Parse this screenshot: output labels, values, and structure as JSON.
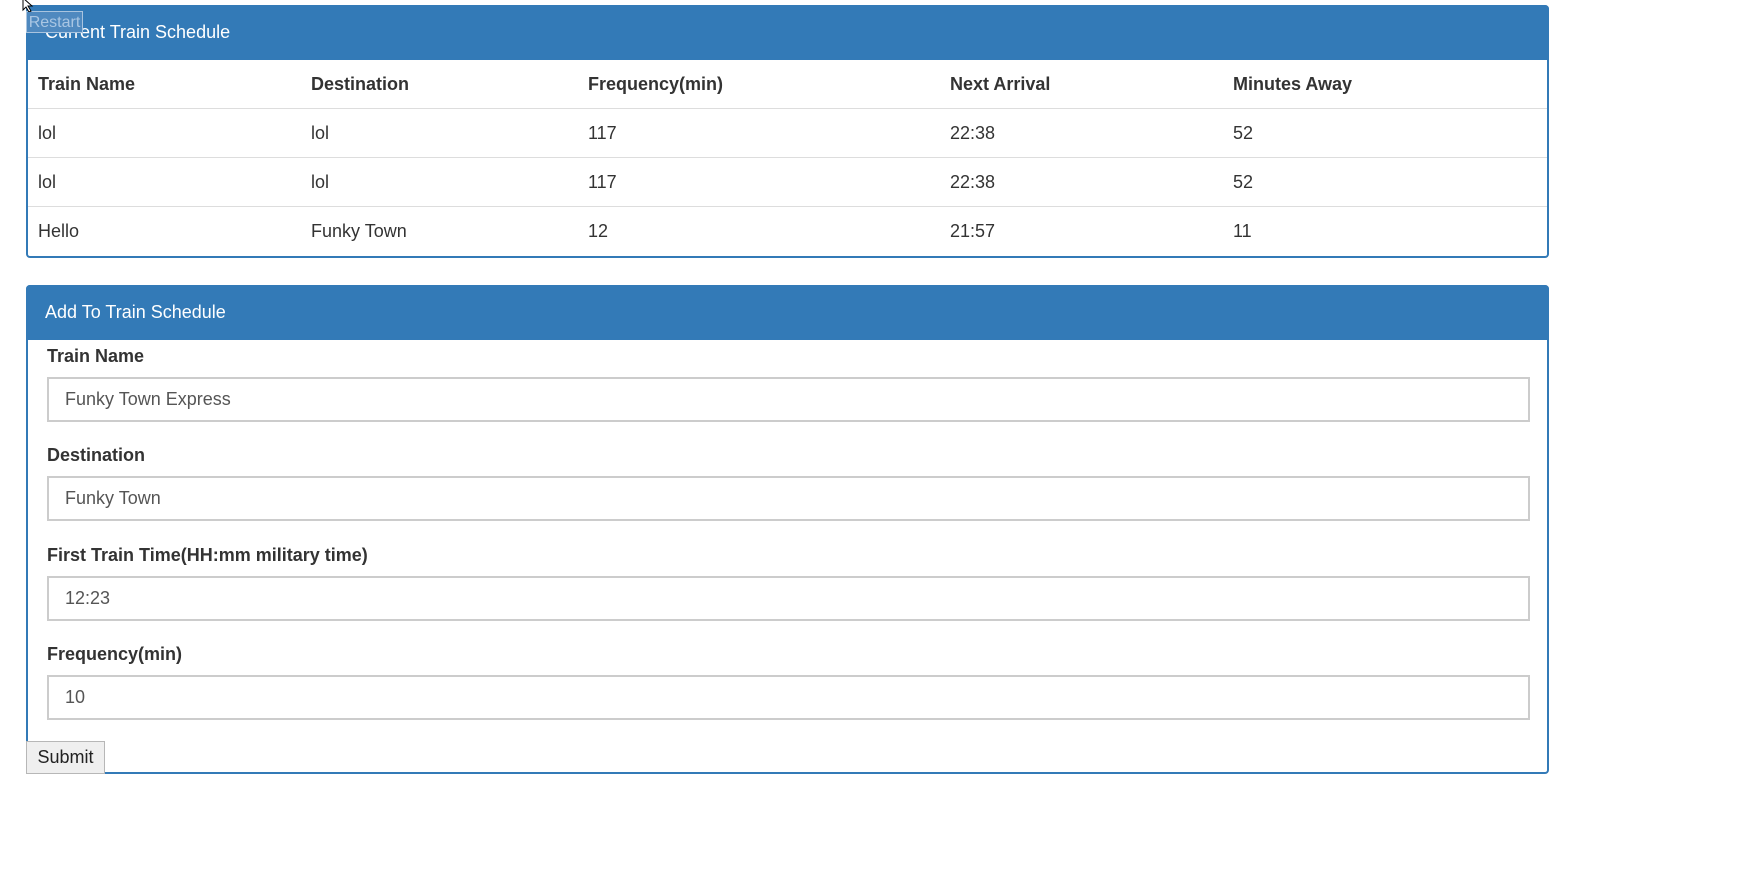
{
  "restart_label": "Restart",
  "schedule": {
    "title": "Current Train Schedule",
    "columns": [
      "Train Name",
      "Destination",
      "Frequency(min)",
      "Next Arrival",
      "Minutes Away"
    ],
    "rows": [
      [
        "lol",
        "lol",
        "117",
        "22:38",
        "52"
      ],
      [
        "lol",
        "lol",
        "117",
        "22:38",
        "52"
      ],
      [
        "Hello",
        "Funky Town",
        "12",
        "21:57",
        "11"
      ]
    ]
  },
  "form": {
    "title": "Add To Train Schedule",
    "train_name": {
      "label": "Train Name",
      "value": "Funky Town Express"
    },
    "destination": {
      "label": "Destination",
      "value": "Funky Town"
    },
    "first_train_time": {
      "label": "First Train Time(HH:mm military time)",
      "value": "12:23"
    },
    "frequency": {
      "label": "Frequency(min)",
      "value": "10"
    },
    "submit_label": "Submit"
  },
  "colors": {
    "panel_primary": "#337ab7"
  }
}
